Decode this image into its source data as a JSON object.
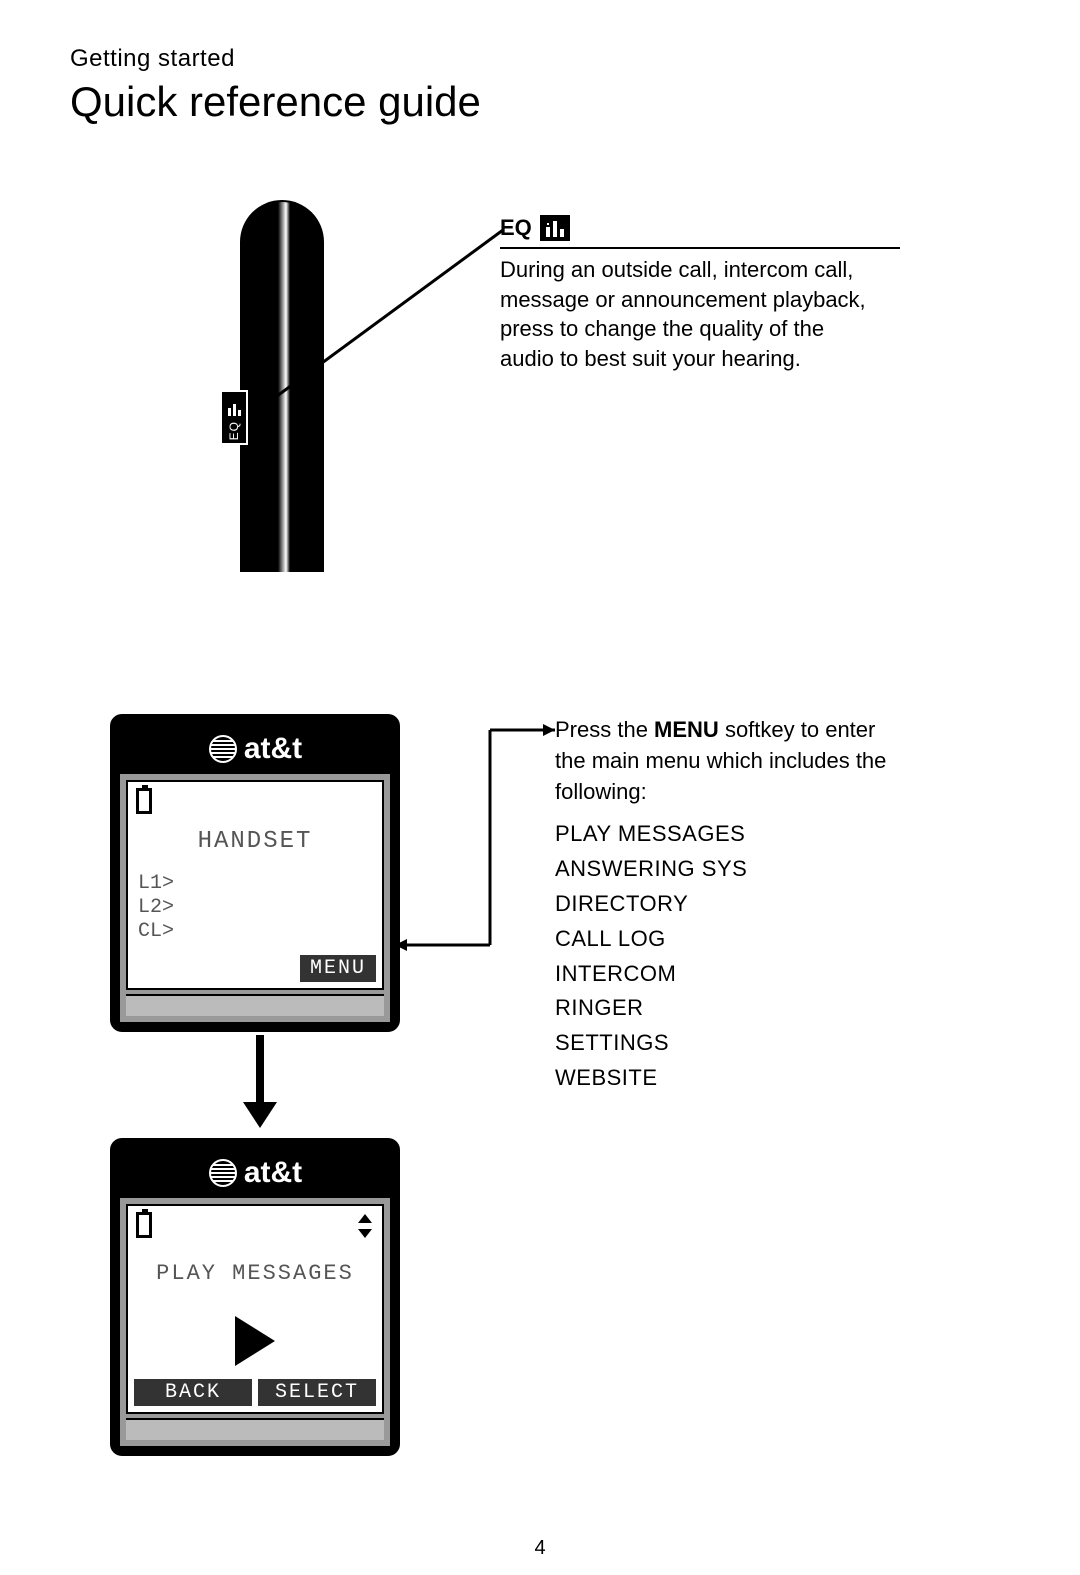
{
  "header": {
    "pretitle": "Getting started",
    "title": "Quick reference guide"
  },
  "eq": {
    "label": "EQ",
    "button_label": "EQ",
    "description": "During an outside call, intercom call, message or announcement playback, press to change the quality of the audio to best suit your hearing."
  },
  "phone1": {
    "brand": "at&t",
    "screen_title": "HANDSET",
    "lines": [
      "L1>",
      "L2>",
      "CL>"
    ],
    "softkey_right": "MENU"
  },
  "phone2": {
    "brand": "at&t",
    "screen_title": "PLAY MESSAGES",
    "softkey_left": "BACK",
    "softkey_right": "SELECT"
  },
  "menu": {
    "intro_prefix": "Press the ",
    "intro_bold": "MENU",
    "intro_suffix": " softkey to enter the main menu which includes the following:",
    "items": [
      "PLAY MESSAGES",
      "ANSWERING SYS",
      "DIRECTORY",
      "CALL LOG",
      "INTERCOM",
      "RINGER",
      "SETTINGS",
      "WEBSITE"
    ]
  },
  "page_number": "4"
}
